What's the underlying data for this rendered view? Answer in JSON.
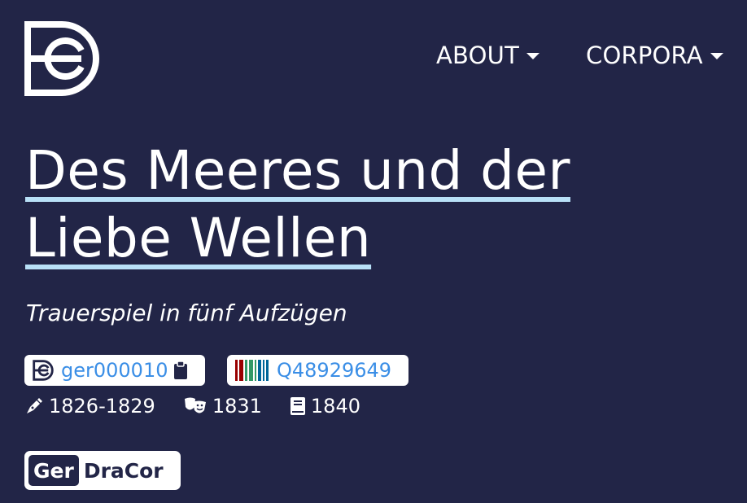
{
  "header": {
    "nav": [
      {
        "label": "ABOUT",
        "icon": "caret-down-icon"
      },
      {
        "label": "CORPORA",
        "icon": "caret-down-icon"
      }
    ],
    "logo_icon": "dracor-logo"
  },
  "play": {
    "title": "Des Meeres und der Liebe Wellen",
    "subtitle": "Trauerspiel in fünf Aufzügen",
    "dracor_id": "ger000010",
    "wikidata_id": "Q48929649",
    "written_year": "1826-1829",
    "premiere_year": "1831",
    "print_year": "1840"
  },
  "corpus": {
    "prefix": "Ger",
    "name": "DraCor"
  },
  "colors": {
    "background": "#222547",
    "accent_underline": "#b8e0f7",
    "link": "#3a8ee6",
    "text": "#ffffff"
  },
  "icons": {
    "id_badge": "dracor-small-icon",
    "copy": "clipboard-icon",
    "wikidata": "wikidata-barcode-icon",
    "written": "pen-nib-icon",
    "premiere": "theater-masks-icon",
    "print": "book-icon"
  }
}
